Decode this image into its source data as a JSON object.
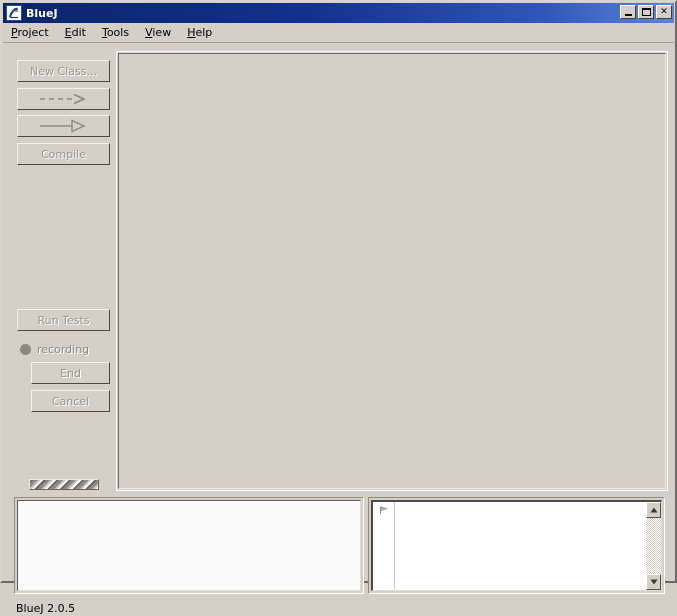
{
  "window": {
    "title": "BlueJ",
    "app_icon": "bluej-logo-icon",
    "minimize_label": "Minimize",
    "maximize_label": "Maximize",
    "close_label": "✕"
  },
  "menubar": {
    "items": [
      {
        "label": "Project",
        "mnemonic": "P",
        "rest": "roject",
        "name": "menu-project"
      },
      {
        "label": "Edit",
        "mnemonic": "E",
        "rest": "dit",
        "name": "menu-edit"
      },
      {
        "label": "Tools",
        "mnemonic": "T",
        "rest": "ools",
        "name": "menu-tools"
      },
      {
        "label": "View",
        "mnemonic": "V",
        "rest": "iew",
        "name": "menu-view"
      },
      {
        "label": "Help",
        "mnemonic": "H",
        "rest": "elp",
        "name": "menu-help"
      }
    ]
  },
  "toolbar": {
    "new_class_label": "New Class...",
    "uses_arrow_label": "",
    "inherits_arrow_label": "",
    "compile_label": "Compile",
    "new_class_enabled": false,
    "uses_enabled": false,
    "inherits_enabled": false,
    "compile_enabled": false
  },
  "testing": {
    "run_tests_label": "Run Tests",
    "recording_label": "recording",
    "recording_active": false,
    "end_label": "End",
    "cancel_label": "Cancel"
  },
  "class_diagram": {
    "empty": true,
    "classes": []
  },
  "object_bench": {
    "empty": true,
    "objects": []
  },
  "codepad": {
    "prompt_marker": "prompt-flag-icon",
    "lines": [],
    "scroll_up_label": "▲",
    "scroll_down_label": "▼"
  },
  "statusbar": {
    "text": "BlueJ 2.0.5"
  },
  "colors": {
    "window_bg": "#d4d0c8",
    "title_start": "#0a246a",
    "title_end": "#5d84d6",
    "panel_white": "#ffffff",
    "disabled_text": "#9a958c",
    "status_text": "#000000"
  }
}
